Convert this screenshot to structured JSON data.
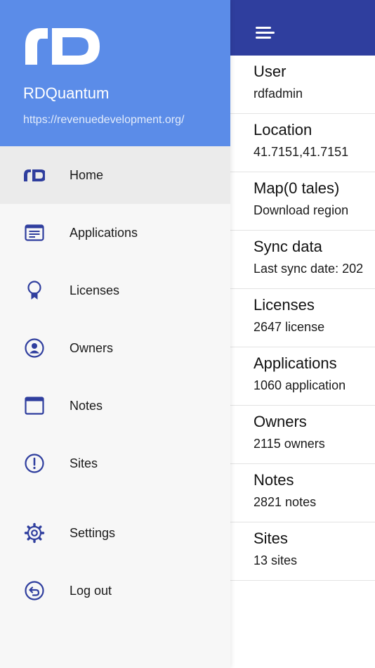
{
  "header": {
    "app_name": "RDQuantum",
    "url": "https://revenuedevelopment.org/",
    "logo_text": "rD"
  },
  "nav": {
    "items": [
      {
        "label": "Home",
        "icon": "rd-logo-icon",
        "active": true
      },
      {
        "label": "Applications",
        "icon": "applications-icon"
      },
      {
        "label": "Licenses",
        "icon": "ribbon-icon"
      },
      {
        "label": "Owners",
        "icon": "user-circle-icon"
      },
      {
        "label": "Notes",
        "icon": "window-icon"
      },
      {
        "label": "Sites",
        "icon": "alert-circle-icon"
      },
      {
        "label": "Settings",
        "icon": "gear-icon"
      },
      {
        "label": "Log out",
        "icon": "logout-icon"
      }
    ]
  },
  "main": {
    "cards": [
      {
        "title": "User",
        "value": "rdfadmin"
      },
      {
        "title": "Location",
        "value": "41.7151,41.7151"
      },
      {
        "title": "Map(0 tales)",
        "value": "Download region"
      },
      {
        "title": "Sync data",
        "value": "Last sync date: 202"
      },
      {
        "title": "Licenses",
        "value": "2647 license"
      },
      {
        "title": "Applications",
        "value": "1060 application"
      },
      {
        "title": "Owners",
        "value": "2115 owners"
      },
      {
        "title": "Notes",
        "value": "2821 notes"
      },
      {
        "title": "Sites",
        "value": "13 sites"
      }
    ]
  },
  "colors": {
    "drawer_header": "#5b8ce8",
    "main_header": "#2f3e9e",
    "icon": "#2f3e9e",
    "active_item_bg": "#ebebeb"
  }
}
